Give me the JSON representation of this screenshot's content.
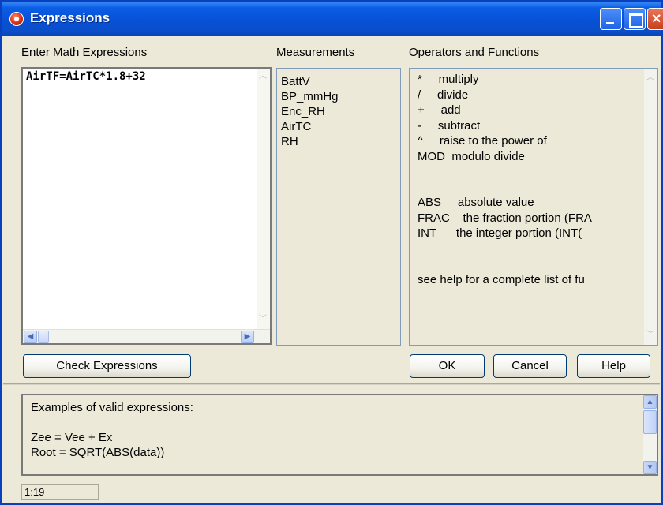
{
  "window": {
    "title": "Expressions"
  },
  "labels": {
    "enter_math": "Enter Math Expressions",
    "measurements": "Measurements",
    "operators": "Operators and Functions"
  },
  "expression_text": "AirTF=AirTC*1.8+32",
  "measurements": [
    "BattV",
    "BP_mmHg",
    "Enc_RH",
    "AirTC",
    "RH"
  ],
  "operators": [
    "*     multiply",
    "/     divide",
    "+     add",
    "-     subtract",
    "^     raise to the power of",
    "MOD  modulo divide",
    "",
    "",
    "ABS     absolute value",
    "FRAC    the fraction portion (FRA",
    "INT      the integer portion (INT(",
    "",
    "",
    "see help for a complete list of fu"
  ],
  "buttons": {
    "check": "Check Expressions",
    "ok": "OK",
    "cancel": "Cancel",
    "help": "Help"
  },
  "examples": {
    "heading": "Examples of valid expressions:",
    "line1": "Zee = Vee + Ex",
    "line2": "Root = SQRT(ABS(data))"
  },
  "status": {
    "position": "1:19"
  },
  "colors": {
    "titlebar": "#0751d6",
    "window_bg": "#ece9d8",
    "list_border": "#7f9db9"
  }
}
